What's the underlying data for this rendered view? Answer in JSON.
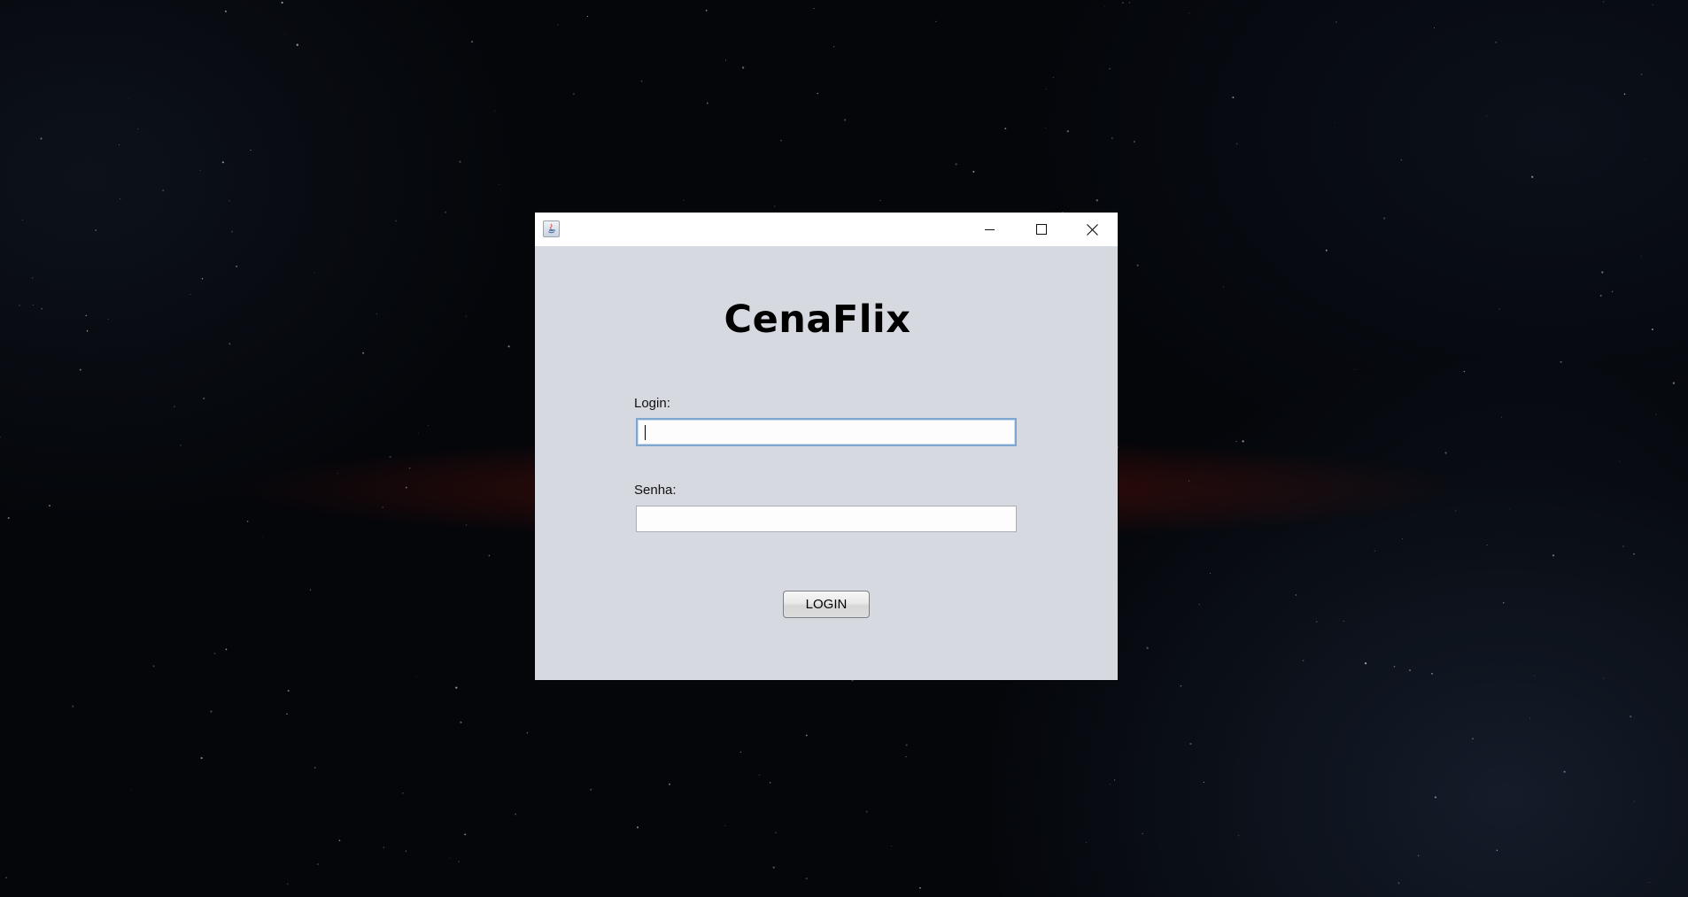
{
  "window": {
    "title": "",
    "app_icon": "java-icon",
    "controls": {
      "minimize": "minimize-icon",
      "maximize": "maximize-icon",
      "close": "close-icon"
    }
  },
  "form": {
    "brand": "CenaFlix",
    "login_label": "Login:",
    "login_value": "",
    "senha_label": "Senha:",
    "senha_value": "",
    "submit_label": "LOGIN"
  },
  "colors": {
    "window_bg": "#d6d9e0",
    "focus_border": "#7ea6cf",
    "desktop_glow": "#ff3c14"
  }
}
